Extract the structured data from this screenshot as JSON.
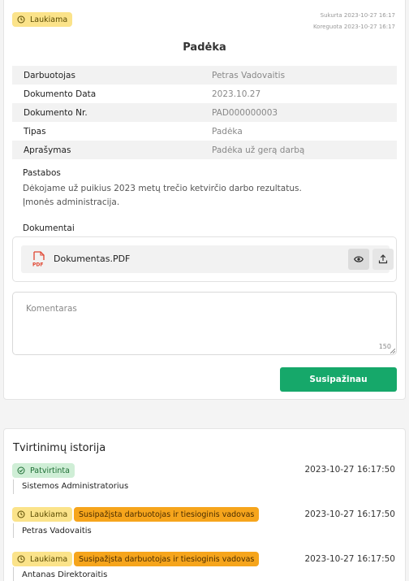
{
  "status_badge": {
    "label": "Laukiama",
    "icon": "clock-icon"
  },
  "meta": {
    "created": "Sukurta 2023-10-27 16:17",
    "modified": "Koreguota 2023-10-27 16:17"
  },
  "title": "Padėka",
  "details": [
    {
      "label": "Darbuotojas",
      "value": "Petras Vadovaitis"
    },
    {
      "label": "Dokumento Data",
      "value": "2023.10.27"
    },
    {
      "label": "Dokumento Nr.",
      "value": "PAD000000003"
    },
    {
      "label": "Tipas",
      "value": "Padėka"
    },
    {
      "label": "Aprašymas",
      "value": "Padėka už gerą darbą"
    }
  ],
  "notes": {
    "label": "Pastabos",
    "line1": "Dėkojame už puikius 2023 metų trečio ketvirčio darbo rezultatus.",
    "line2": "Įmonės administracija."
  },
  "documents": {
    "label": "Dokumentai",
    "items": [
      {
        "name": "Dokumentas.PDF",
        "icon": "pdf-file-icon"
      }
    ]
  },
  "comment": {
    "placeholder": "Komentaras",
    "counter": "150"
  },
  "confirm_button": "Susipažinau",
  "history": {
    "title": "Tvirtinimų istorija",
    "entries": [
      {
        "status": "Patvirtinta",
        "tag": "",
        "date": "2023-10-27 16:17:50",
        "name": "Sistemos Administratorius"
      },
      {
        "status": "Laukiama",
        "tag": "Susipažįsta darbuotojas ir tiesioginis vadovas",
        "date": "2023-10-27 16:17:50",
        "name": "Petras Vadovaitis"
      },
      {
        "status": "Laukiama",
        "tag": "Susipažįsta darbuotojas ir tiesioginis vadovas",
        "date": "2023-10-27 16:17:50",
        "name": "Antanas Direktoraitis"
      }
    ]
  },
  "colors": {
    "primary_green": "#16a86a",
    "waiting_yellow": "#fbe38a",
    "approved_green": "#cfeed6",
    "tag_orange": "#f6a51c"
  }
}
